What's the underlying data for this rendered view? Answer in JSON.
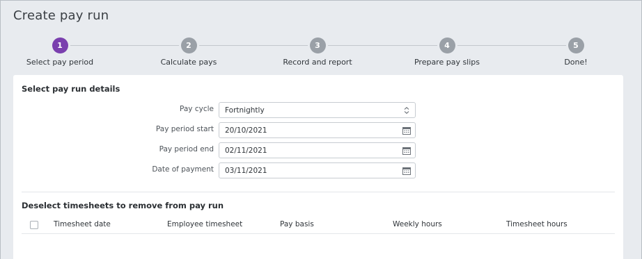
{
  "page": {
    "title": "Create pay run"
  },
  "stepper": {
    "steps": [
      {
        "number": "1",
        "label": "Select pay period",
        "active": true
      },
      {
        "number": "2",
        "label": "Calculate pays",
        "active": false
      },
      {
        "number": "3",
        "label": "Record and report",
        "active": false
      },
      {
        "number": "4",
        "label": "Prepare pay slips",
        "active": false
      },
      {
        "number": "5",
        "label": "Done!",
        "active": false
      }
    ]
  },
  "details": {
    "title": "Select pay run details",
    "pay_cycle": {
      "label": "Pay cycle",
      "value": "Fortnightly"
    },
    "period_start": {
      "label": "Pay period start",
      "value": "20/10/2021"
    },
    "period_end": {
      "label": "Pay period end",
      "value": "02/11/2021"
    },
    "payment_date": {
      "label": "Date of payment",
      "value": "03/11/2021"
    }
  },
  "timesheets": {
    "title": "Deselect timesheets to remove from pay run",
    "columns": [
      "Timesheet date",
      "Employee timesheet",
      "Pay basis",
      "Weekly hours",
      "Timesheet hours"
    ]
  },
  "icons": {
    "calendar": "calendar-icon",
    "select": "up-down-chevron-icon"
  },
  "colors": {
    "accent": "#7a3fae",
    "inactive_step": "#9aa0a7",
    "background": "#e8ebef"
  }
}
